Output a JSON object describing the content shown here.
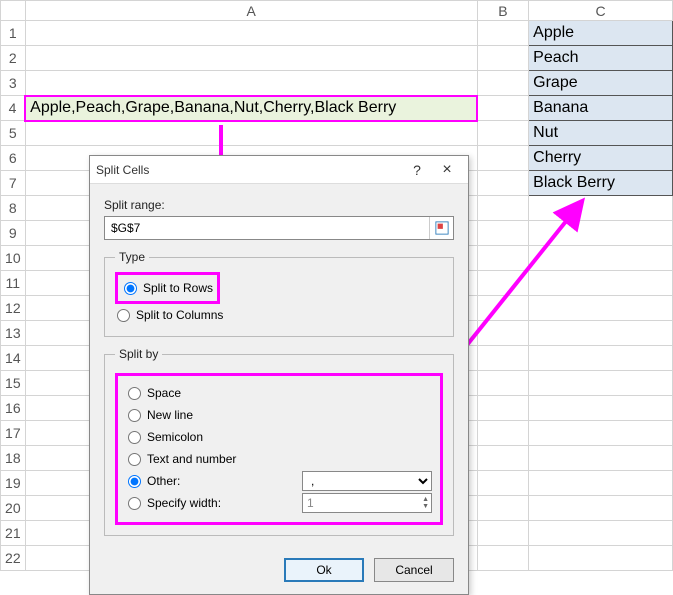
{
  "columns": [
    "A",
    "B",
    "C"
  ],
  "rowCount": 22,
  "sourceCell": "Apple,Peach,Grape,Banana,Nut,Cherry,Black Berry",
  "results": [
    "Apple",
    "Peach",
    "Grape",
    "Banana",
    "Nut",
    "Cherry",
    "Black Berry"
  ],
  "dialog": {
    "title": "Split Cells",
    "help": "?",
    "close": "×",
    "rangeLabel": "Split range:",
    "rangeValue": "$G$7",
    "typeLegend": "Type",
    "typeRows": "Split to Rows",
    "typeCols": "Split to Columns",
    "splitByLegend": "Split by",
    "bySpace": "Space",
    "byNewline": "New line",
    "bySemicolon": "Semicolon",
    "byTextNum": "Text and number",
    "byOther": "Other:",
    "otherValue": ",",
    "byWidth": "Specify width:",
    "widthValue": "1",
    "ok": "Ok",
    "cancel": "Cancel"
  }
}
